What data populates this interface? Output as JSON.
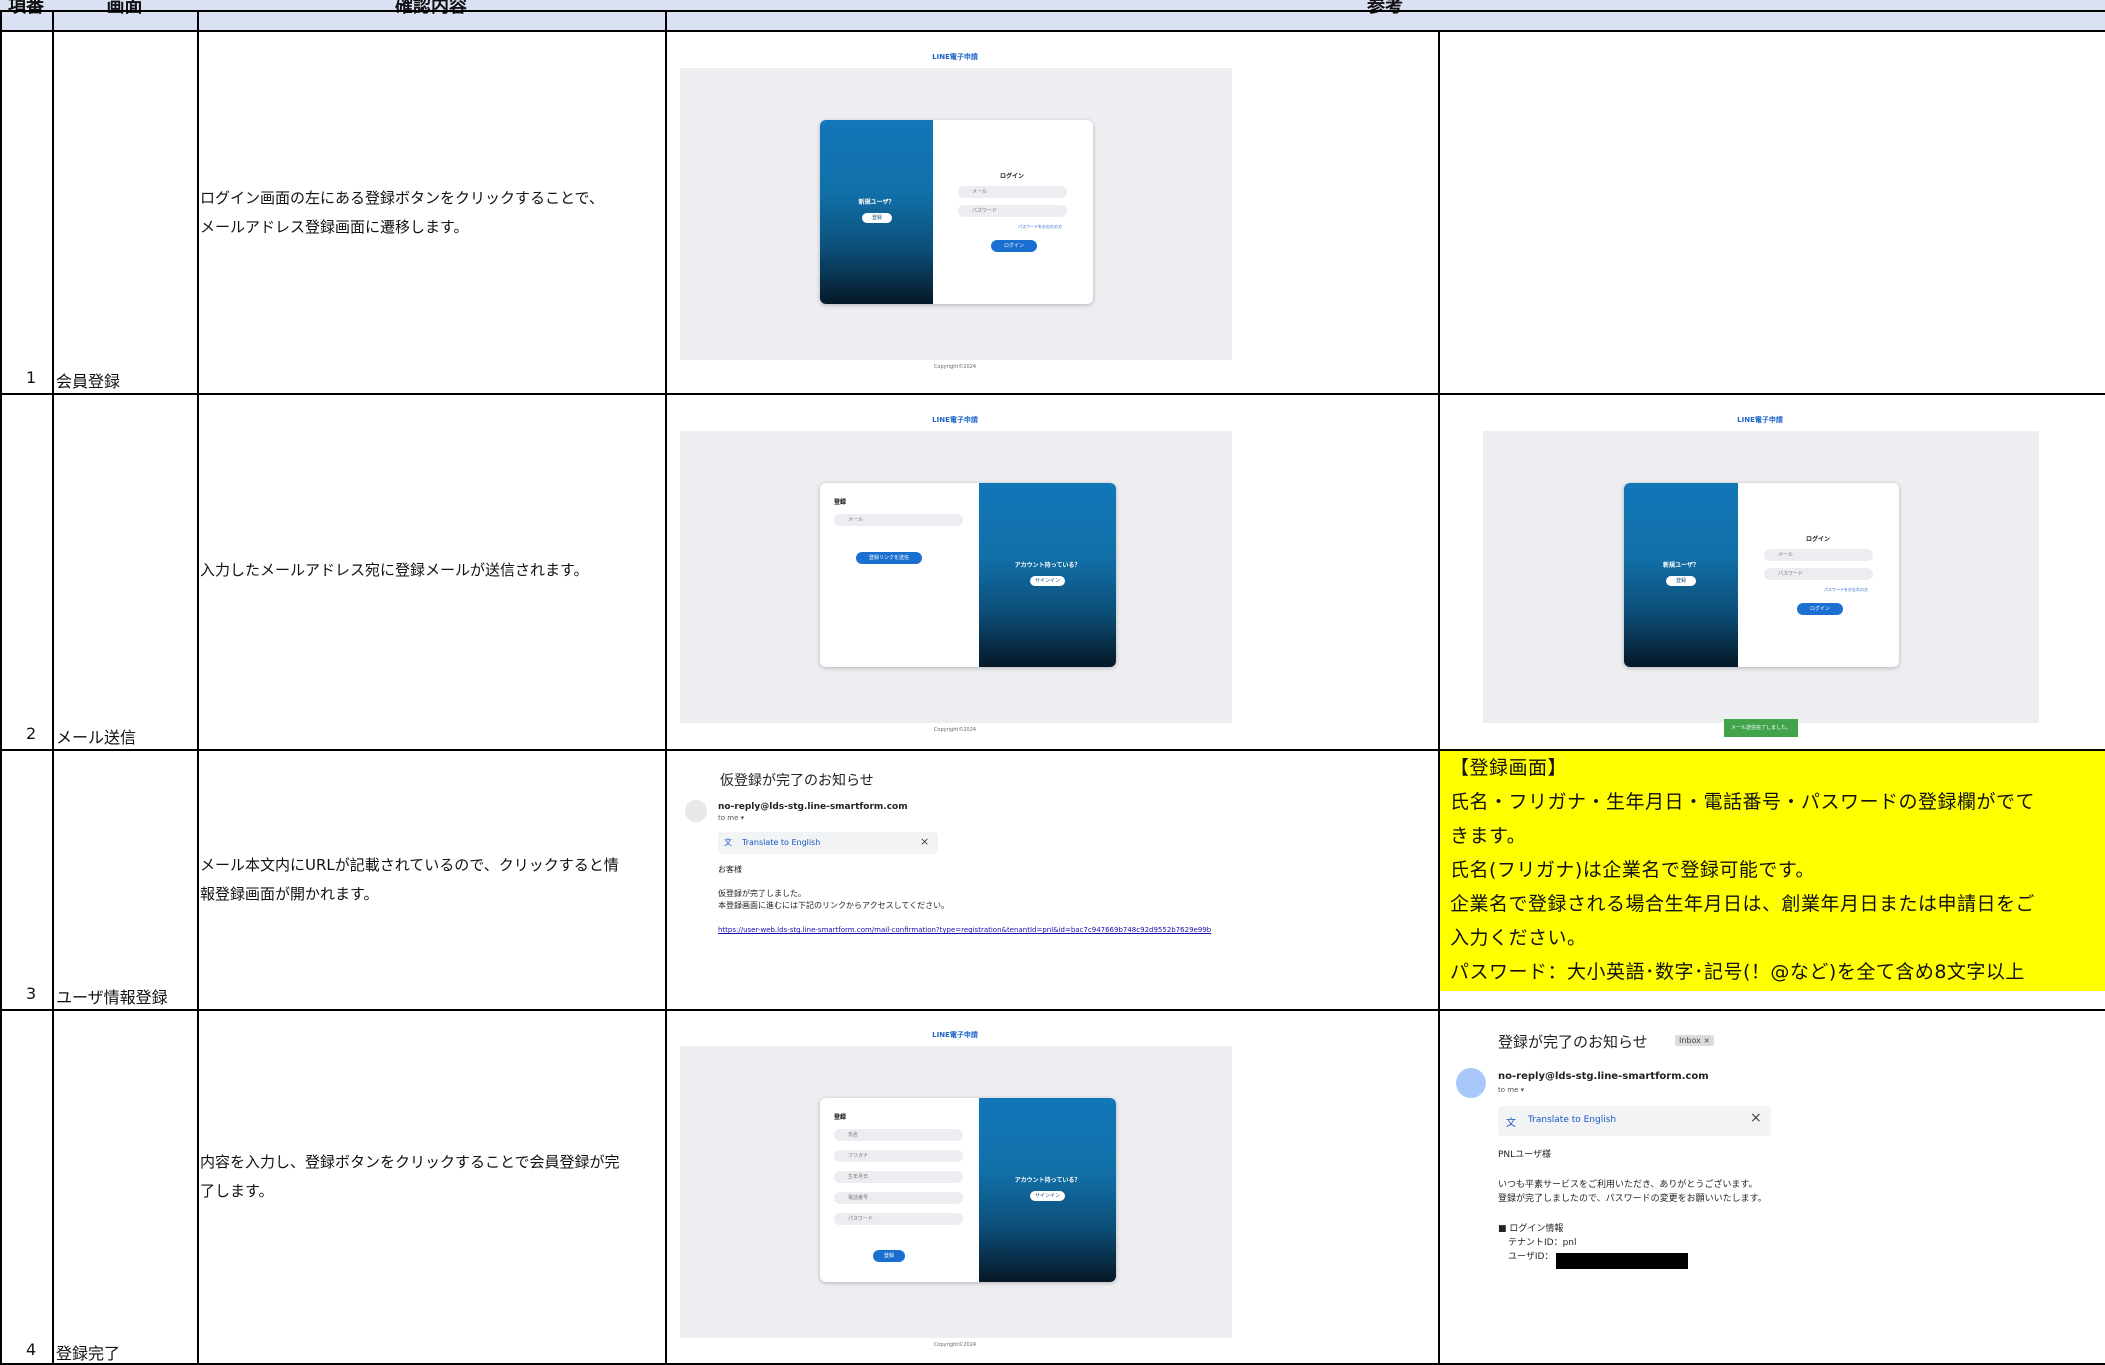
{
  "header": {
    "col_no": "項番",
    "col_screen": "画面",
    "col_content": "確認内容",
    "col_ref": "参考"
  },
  "rows": [
    {
      "no": "1",
      "screen": "会員登録",
      "content": [
        "ログイン画面の左にある登録ボタンをクリックすることで、",
        "メールアドレス登録画面に遷移します。"
      ]
    },
    {
      "no": "2",
      "screen": "メール送信",
      "content": [
        "入力したメールアドレス宛に登録メールが送信されます。"
      ]
    },
    {
      "no": "3",
      "screen": "ユーザ情報登録",
      "content": [
        "メール本文内にURLが記載されているので、クリックすると情",
        "報登録画面が開かれます。"
      ]
    },
    {
      "no": "4",
      "screen": "登録完了",
      "content": [
        "内容を入力し、登録ボタンをクリックすることで会員登録が完",
        "了します。"
      ]
    }
  ],
  "app": {
    "title": "LINE電子申請",
    "copyright": "Copyright©2024",
    "new_user": "新規ユーザ？",
    "register_btn": "登録",
    "login_title": "ログイン",
    "email_placeholder": "メール",
    "password_placeholder": "パスワード",
    "forgot_password": "パスワードをお忘れの方",
    "login_btn": "ログイン",
    "register_title": "登録",
    "send_link_btn": "登録リンクを送信",
    "have_account": "アカウント持っている？",
    "signin_btn": "サインイン",
    "mail_sent_toast": "メール送信完了しました。",
    "name_placeholder": "氏名",
    "kana_placeholder": "フリガナ",
    "birth_placeholder": "生年月日",
    "phone_placeholder": "電話番号"
  },
  "mail1": {
    "subject": "仮登録が完了のお知らせ",
    "sender": "no-reply@lds-stg.line-smartform.com",
    "to": "to me ▾",
    "translate": "Translate to English",
    "greeting": "お客様",
    "body1": "仮登録が完了しました。",
    "body2": "本登録画面に進むには下記のリンクからアクセスしてください。",
    "link": "https://user-web.lds-stg.line-smartform.com/mail-confirmation?type=registration&tenantId=pnl&id=bac7c947669b748c92d9552b7629e99b"
  },
  "mail2": {
    "subject": "登録が完了のお知らせ",
    "inbox": "Inbox ×",
    "sender": "no-reply@lds-stg.line-smartform.com",
    "to": "to me ▾",
    "translate": "Translate to English",
    "greeting": "PNLユーザ様",
    "body1": "いつも平素サービスをご利用いただき、ありがとうございます。",
    "body2": "登録が完了しましたので、パスワードの変更をお願いいたします。",
    "info_title": "■ ログイン情報",
    "tenant": "テナントID：pnl",
    "user": "ユーザID："
  },
  "note": {
    "lines": [
      "【登録画面】",
      "氏名・フリガナ・生年月日・電話番号・パスワードの登録欄がでて",
      "きます。",
      "氏名(フリガナ)は企業名で登録可能です。",
      "企業名で登録される場合生年月日は、創業年月日または申請日をご",
      "入力ください。",
      "パスワード：大小英語･数字･記号(！@など)を全て含め8文字以上"
    ]
  }
}
